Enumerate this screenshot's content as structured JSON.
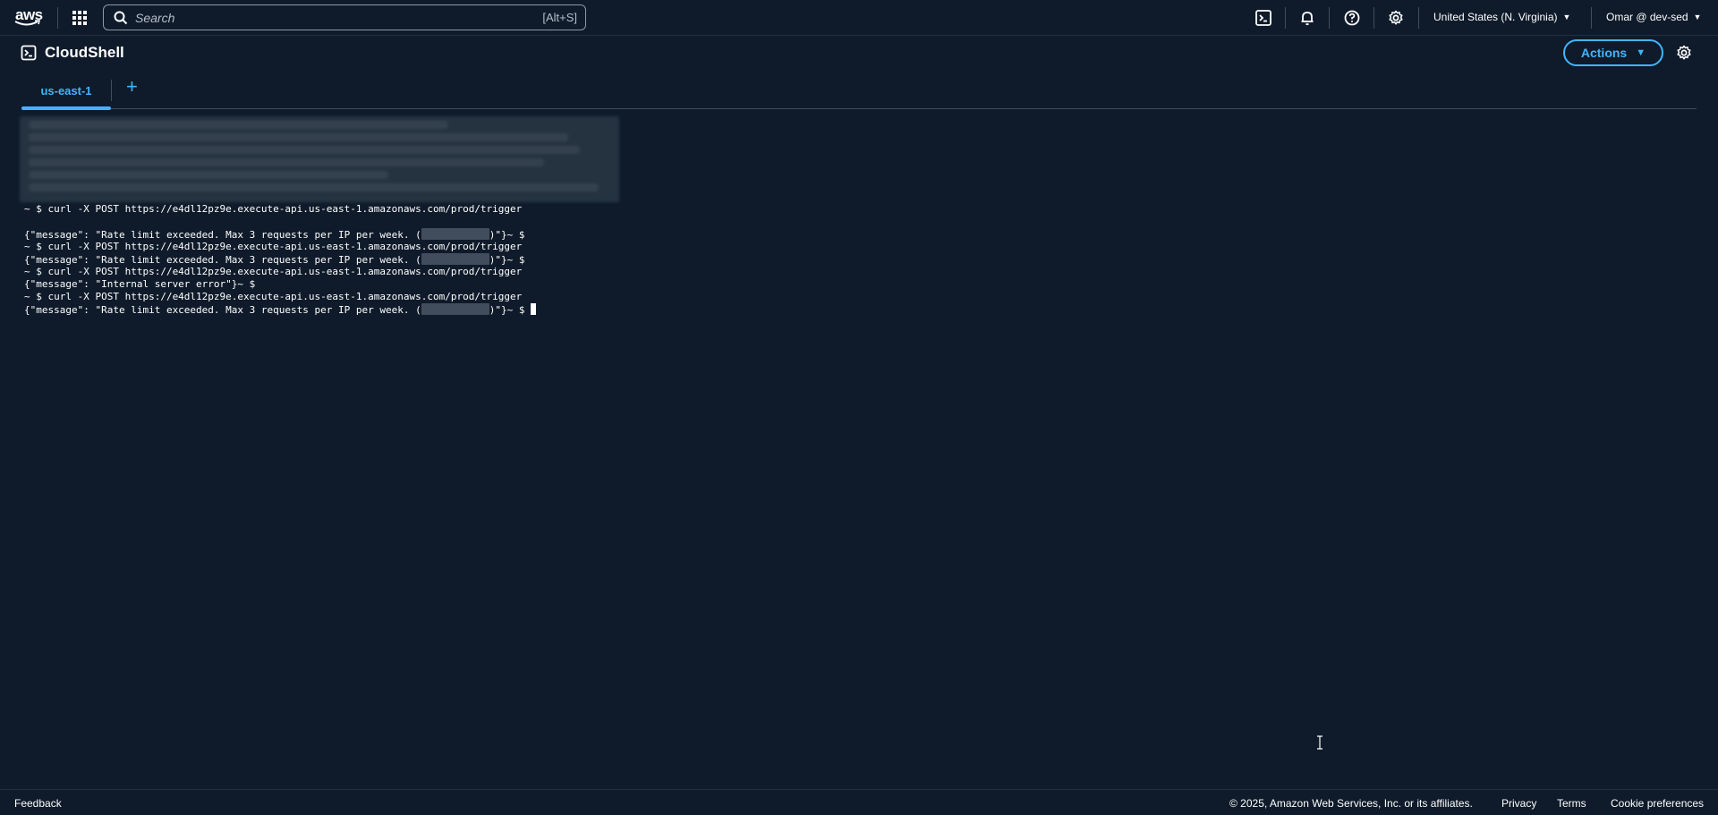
{
  "nav": {
    "logo_text": "aws",
    "search_placeholder": "Search",
    "search_shortcut": "[Alt+S]",
    "region": "United States (N. Virginia)",
    "account": "Omar @ dev-sed",
    "icons": [
      "cloudshell-icon",
      "bell-icon",
      "help-icon",
      "gear-icon"
    ]
  },
  "header": {
    "title": "CloudShell",
    "actions_label": "Actions"
  },
  "tabs": [
    {
      "label": "us-east-1",
      "active": true
    }
  ],
  "tab_add_label": "+",
  "terminal": {
    "lines": [
      "~ $ curl -X POST https://e4dl12pz9e.execute-api.us-east-1.amazonaws.com/prod/trigger",
      "",
      "{\"message\": \"Rate limit exceeded. Max 3 requests per IP per week. (",
      ")\"}~ $",
      "~ $ curl -X POST https://e4dl12pz9e.execute-api.us-east-1.amazonaws.com/prod/trigger",
      "{\"message\": \"Rate limit exceeded. Max 3 requests per IP per week. (",
      ")\"}~ $",
      "~ $ curl -X POST https://e4dl12pz9e.execute-api.us-east-1.amazonaws.com/prod/trigger",
      "{\"message\": \"Internal server error\"}~ $",
      "~ $ curl -X POST https://e4dl12pz9e.execute-api.us-east-1.amazonaws.com/prod/trigger",
      "{\"message\": \"Rate limit exceeded. Max 3 requests per IP per week. (",
      ")\"}~ $ "
    ]
  },
  "footer": {
    "feedback": "Feedback",
    "copyright": "© 2025, Amazon Web Services, Inc. or its affiliates.",
    "privacy": "Privacy",
    "terms": "Terms",
    "cookies": "Cookie preferences"
  },
  "colors": {
    "background": "#0f1b2a",
    "accent": "#42b4ff",
    "border": "#414d5c"
  }
}
